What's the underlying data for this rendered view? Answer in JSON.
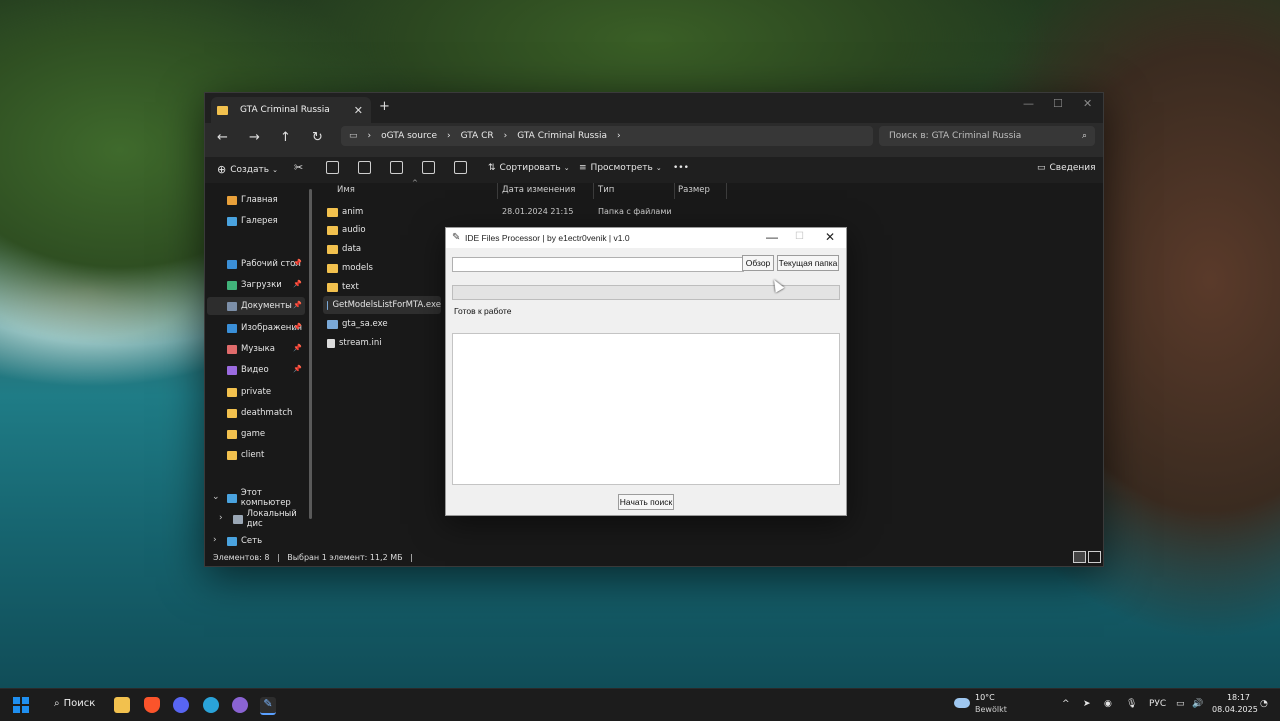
{
  "explorer": {
    "tab_title": "GTA Criminal Russia",
    "new_tab": "+",
    "breadcrumb": [
      "oGTA source",
      "GTA CR",
      "GTA Criminal Russia"
    ],
    "search_placeholder": "Поиск в: GTA Criminal Russia",
    "toolbar": {
      "create": "Создать",
      "sort": "Сортировать",
      "view": "Просмотреть",
      "more": "•••",
      "details": "Сведения"
    },
    "sidebar": [
      {
        "label": "Главная",
        "icon": "home-icon",
        "color": "#e8a03a"
      },
      {
        "label": "Галерея",
        "icon": "gallery-icon",
        "color": "#4aa3df"
      },
      {
        "label": "Рабочий стол",
        "icon": "desktop-icon",
        "color": "#3b8fd6",
        "pinned": true
      },
      {
        "label": "Загрузки",
        "icon": "download-icon",
        "color": "#41b37a",
        "pinned": true
      },
      {
        "label": "Документы",
        "icon": "documents-icon",
        "color": "#7c8fa8",
        "pinned": true,
        "selected": true
      },
      {
        "label": "Изображения",
        "icon": "pictures-icon",
        "color": "#3a8fd8",
        "pinned": true
      },
      {
        "label": "Музыка",
        "icon": "music-icon",
        "color": "#e06b6b",
        "pinned": true
      },
      {
        "label": "Видео",
        "icon": "video-icon",
        "color": "#9b6be0",
        "pinned": true
      },
      {
        "label": "private",
        "icon": "folder-icon",
        "color": "#f2c14e"
      },
      {
        "label": "deathmatch",
        "icon": "folder-icon",
        "color": "#f2c14e"
      },
      {
        "label": "game",
        "icon": "folder-icon",
        "color": "#f2c14e"
      },
      {
        "label": "client",
        "icon": "folder-icon",
        "color": "#f2c14e"
      },
      {
        "label": "Этот компьютер",
        "icon": "computer-icon",
        "color": "#4aa3df"
      },
      {
        "label": "Локальный дис",
        "icon": "drive-icon",
        "color": "#9aa7b5"
      },
      {
        "label": "Сеть",
        "icon": "network-icon",
        "color": "#4aa3df"
      }
    ],
    "columns": [
      "Имя",
      "Дата изменения",
      "Тип",
      "Размер"
    ],
    "files": [
      {
        "name": "anim",
        "date": "28.01.2024 21:15",
        "type": "Папка с файлами",
        "kind": "folder"
      },
      {
        "name": "audio",
        "date": "",
        "type": "",
        "kind": "folder"
      },
      {
        "name": "data",
        "date": "",
        "type": "",
        "kind": "folder"
      },
      {
        "name": "models",
        "date": "",
        "type": "",
        "kind": "folder"
      },
      {
        "name": "text",
        "date": "",
        "type": "",
        "kind": "folder"
      },
      {
        "name": "GetModelsListForMTA.exe",
        "date": "",
        "type": "",
        "kind": "exe",
        "selected": true
      },
      {
        "name": "gta_sa.exe",
        "date": "",
        "type": "",
        "kind": "exe"
      },
      {
        "name": "stream.ini",
        "date": "",
        "type": "",
        "kind": "ini"
      }
    ],
    "status": {
      "count": "Элементов: 8",
      "selection": "Выбран 1 элемент: 11,2 МБ"
    }
  },
  "dialog": {
    "title": "IDE Files Processor | by e1ectr0venik | v1.0",
    "path_value": "",
    "browse_label": "Обзор",
    "current_folder_label": "Текущая папка",
    "progress": 0,
    "status_text": "Готов к работе",
    "output_text": "",
    "start_label": "Начать поиск"
  },
  "taskbar": {
    "search_label": "Поиск",
    "weather_temp": "10°C",
    "weather_desc": "Bewölkt",
    "language": "РУС",
    "time": "18:17",
    "date": "08.04.2025"
  },
  "colors": {
    "accent_folder": "#f2c14e",
    "windows_blue": "#1f8ff0"
  }
}
